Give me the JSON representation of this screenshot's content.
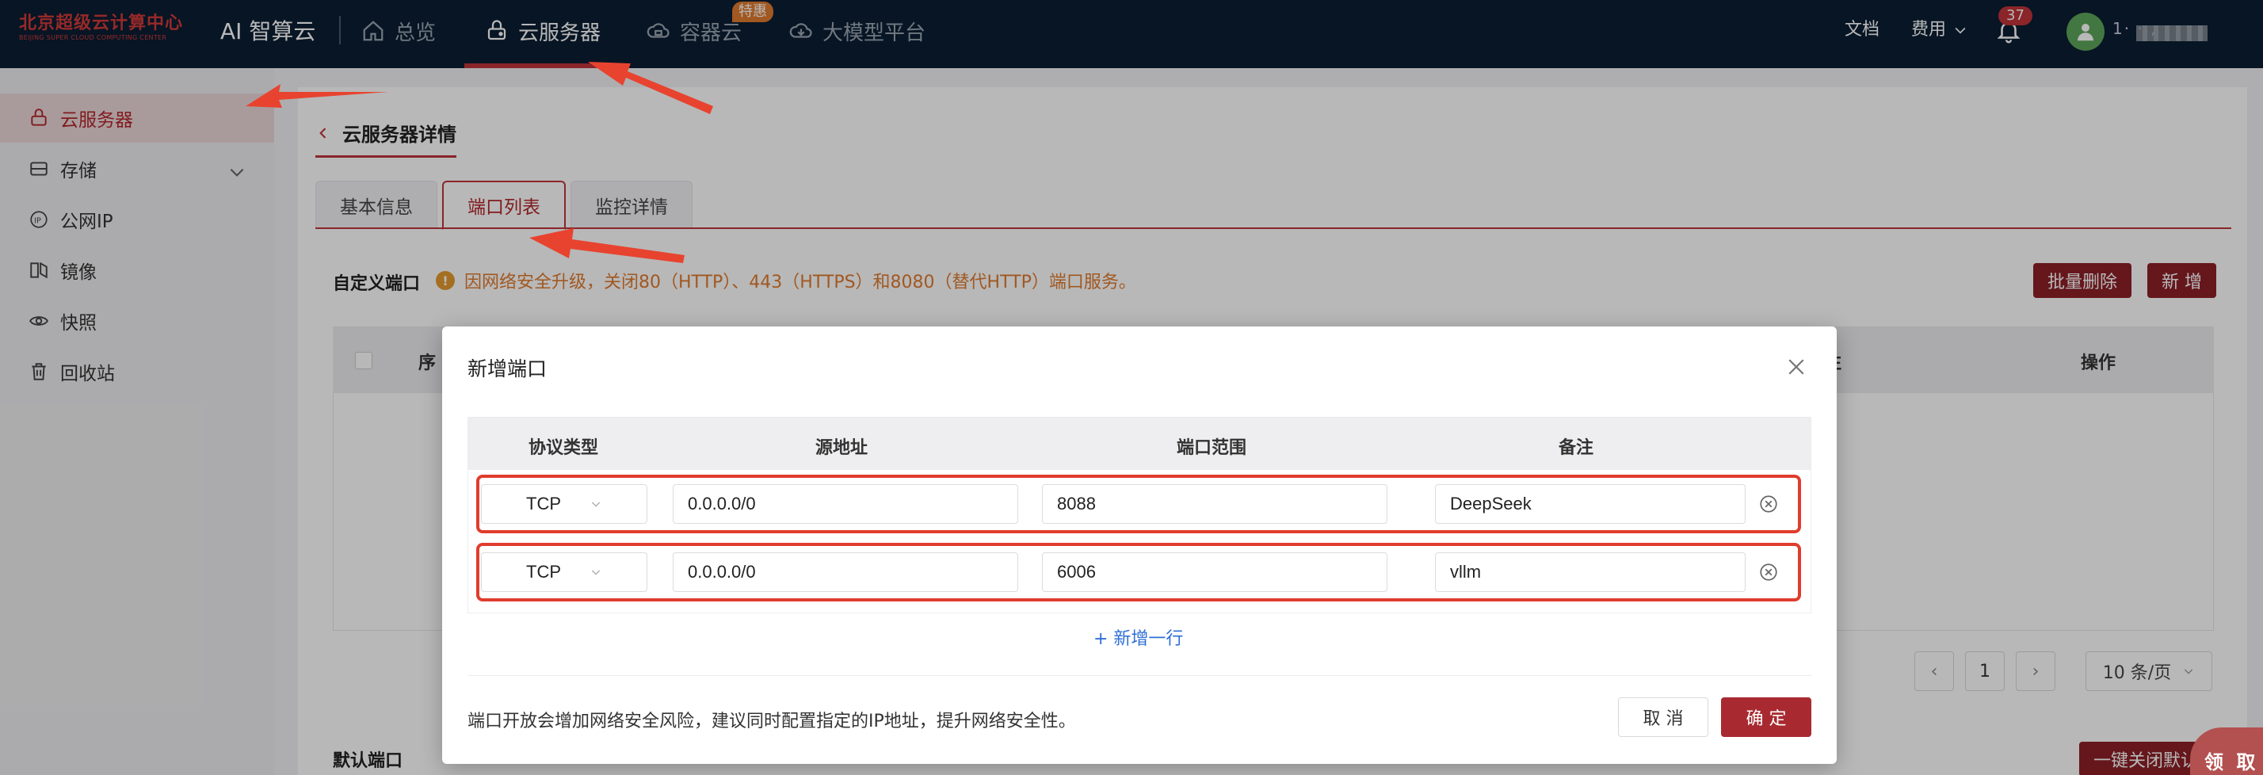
{
  "colors": {
    "nav_bg": "#0b1e33",
    "brand_red": "#c0343a",
    "primary_button": "#a82a30",
    "warning": "#e07a2e",
    "link_blue": "#2f6fd6",
    "annotation_red": "#e03c2e"
  },
  "brand": {
    "cn": "北京超级云计算中心",
    "en": "BEIJING SUPER CLOUD COMPUTING CENTER",
    "product": "AI 智算云"
  },
  "topnav": {
    "items": [
      {
        "label": "总览",
        "icon": "home-icon"
      },
      {
        "label": "云服务器",
        "icon": "server-icon",
        "active": true
      },
      {
        "label": "容器云",
        "icon": "container-cloud-icon",
        "badge": "特惠"
      },
      {
        "label": "大模型平台",
        "icon": "cloud-platform-icon"
      }
    ],
    "docs": "文档",
    "fees": "费用",
    "notifications_count": "37",
    "username_visible": "1·  ·  ,"
  },
  "sidebar": {
    "items": [
      {
        "label": "云服务器",
        "icon": "server-icon",
        "active": true
      },
      {
        "label": "存储",
        "icon": "storage-icon",
        "expandable": true
      },
      {
        "label": "公网IP",
        "icon": "ip-icon"
      },
      {
        "label": "镜像",
        "icon": "image-icon"
      },
      {
        "label": "快照",
        "icon": "snapshot-icon"
      },
      {
        "label": "回收站",
        "icon": "trash-icon"
      }
    ]
  },
  "page": {
    "back_title": "云服务器详情",
    "tabs": [
      {
        "label": "基本信息"
      },
      {
        "label": "端口列表",
        "active": true
      },
      {
        "label": "监控详情"
      }
    ],
    "custom_ports_title": "自定义端口",
    "warning_text": "因网络安全升级，关闭80（HTTP）、443（HTTPS）和8080（替代HTTP）端口服务。",
    "batch_delete": "批量删除",
    "add_new": "新 增",
    "table_columns_visible": [
      "序",
      "注",
      "操作"
    ],
    "pagination": {
      "current_page": "1",
      "page_size": "10 条/页"
    },
    "default_ports_title": "默认端口",
    "one_click_close": "一键关闭默认端口"
  },
  "modal": {
    "title": "新增端口",
    "columns": [
      "协议类型",
      "源地址",
      "端口范围",
      "备注"
    ],
    "rows": [
      {
        "protocol": "TCP",
        "source": "0.0.0.0/0",
        "port_range": "8088",
        "remark": "DeepSeek"
      },
      {
        "protocol": "TCP",
        "source": "0.0.0.0/0",
        "port_range": "6006",
        "remark": "vllm"
      }
    ],
    "add_row": "+ 新增一行",
    "tip": "端口开放会增加网络安全风险，建议同时配置指定的IP地址，提升网络安全性。",
    "cancel": "取 消",
    "confirm": "确 定"
  },
  "floating_badge": "领 取"
}
